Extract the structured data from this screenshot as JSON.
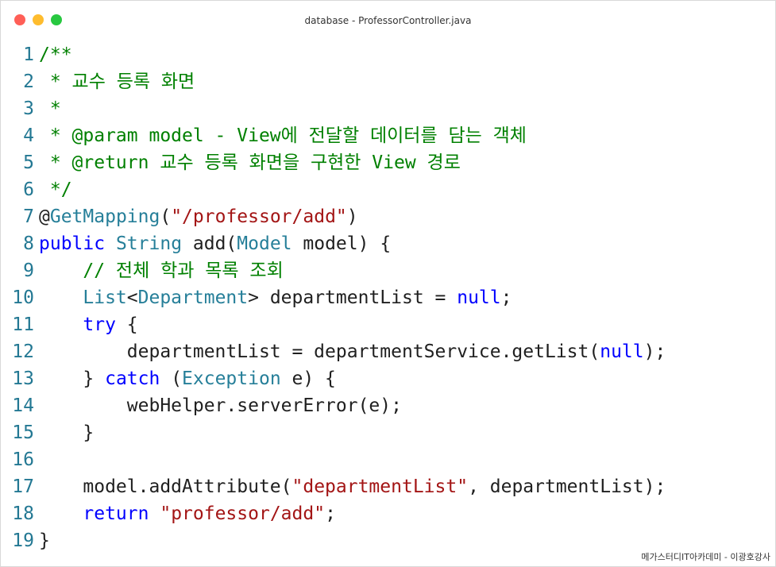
{
  "window": {
    "title": "database - ProfessorController.java",
    "controls": {
      "close_color": "#ff5f57",
      "minimize_color": "#febc2e",
      "maximize_color": "#28c840"
    }
  },
  "colors": {
    "comment": "#008000",
    "keyword": "#0000ff",
    "type": "#267f99",
    "string": "#a31515",
    "plain": "#1f1f1f",
    "line_number": "#237893"
  },
  "code_lines": [
    {
      "n": "1",
      "tokens": [
        {
          "t": "/**",
          "c": "comment"
        }
      ]
    },
    {
      "n": "2",
      "tokens": [
        {
          "t": " * 교수 등록 화면",
          "c": "comment"
        }
      ]
    },
    {
      "n": "3",
      "tokens": [
        {
          "t": " *",
          "c": "comment"
        }
      ]
    },
    {
      "n": "4",
      "tokens": [
        {
          "t": " * @param model - View에 전달할 데이터를 담는 객체",
          "c": "comment"
        }
      ]
    },
    {
      "n": "5",
      "tokens": [
        {
          "t": " * @return 교수 등록 화면을 구현한 View 경로",
          "c": "comment"
        }
      ]
    },
    {
      "n": "6",
      "tokens": [
        {
          "t": " */",
          "c": "comment"
        }
      ]
    },
    {
      "n": "7",
      "tokens": [
        {
          "t": "@",
          "c": "plain"
        },
        {
          "t": "GetMapping",
          "c": "type"
        },
        {
          "t": "(",
          "c": "plain"
        },
        {
          "t": "\"/professor/add\"",
          "c": "string"
        },
        {
          "t": ")",
          "c": "plain"
        }
      ]
    },
    {
      "n": "8",
      "tokens": [
        {
          "t": "public",
          "c": "keyword"
        },
        {
          "t": " ",
          "c": "plain"
        },
        {
          "t": "String",
          "c": "type"
        },
        {
          "t": " add(",
          "c": "plain"
        },
        {
          "t": "Model",
          "c": "type"
        },
        {
          "t": " model) {",
          "c": "plain"
        }
      ]
    },
    {
      "n": "9",
      "tokens": [
        {
          "t": "    // 전체 학과 목록 조회",
          "c": "comment"
        }
      ]
    },
    {
      "n": "10",
      "tokens": [
        {
          "t": "    ",
          "c": "plain"
        },
        {
          "t": "List",
          "c": "type"
        },
        {
          "t": "<",
          "c": "plain"
        },
        {
          "t": "Department",
          "c": "type"
        },
        {
          "t": "> departmentList = ",
          "c": "plain"
        },
        {
          "t": "null",
          "c": "keyword"
        },
        {
          "t": ";",
          "c": "plain"
        }
      ]
    },
    {
      "n": "11",
      "tokens": [
        {
          "t": "    ",
          "c": "plain"
        },
        {
          "t": "try",
          "c": "keyword"
        },
        {
          "t": " {",
          "c": "plain"
        }
      ]
    },
    {
      "n": "12",
      "tokens": [
        {
          "t": "        departmentList = departmentService.getList(",
          "c": "plain"
        },
        {
          "t": "null",
          "c": "keyword"
        },
        {
          "t": ");",
          "c": "plain"
        }
      ]
    },
    {
      "n": "13",
      "tokens": [
        {
          "t": "    } ",
          "c": "plain"
        },
        {
          "t": "catch",
          "c": "keyword"
        },
        {
          "t": " (",
          "c": "plain"
        },
        {
          "t": "Exception",
          "c": "type"
        },
        {
          "t": " e) {",
          "c": "plain"
        }
      ]
    },
    {
      "n": "14",
      "tokens": [
        {
          "t": "        webHelper.serverError(e);",
          "c": "plain"
        }
      ]
    },
    {
      "n": "15",
      "tokens": [
        {
          "t": "    }",
          "c": "plain"
        }
      ]
    },
    {
      "n": "16",
      "tokens": [
        {
          "t": "",
          "c": "plain"
        }
      ]
    },
    {
      "n": "17",
      "tokens": [
        {
          "t": "    model.addAttribute(",
          "c": "plain"
        },
        {
          "t": "\"departmentList\"",
          "c": "string"
        },
        {
          "t": ", departmentList);",
          "c": "plain"
        }
      ]
    },
    {
      "n": "18",
      "tokens": [
        {
          "t": "    ",
          "c": "plain"
        },
        {
          "t": "return",
          "c": "keyword"
        },
        {
          "t": " ",
          "c": "plain"
        },
        {
          "t": "\"professor/add\"",
          "c": "string"
        },
        {
          "t": ";",
          "c": "plain"
        }
      ]
    },
    {
      "n": "19",
      "tokens": [
        {
          "t": "}",
          "c": "plain"
        }
      ]
    }
  ],
  "footer": {
    "credit": "메가스터디IT아카데미 - 이광호강사"
  }
}
